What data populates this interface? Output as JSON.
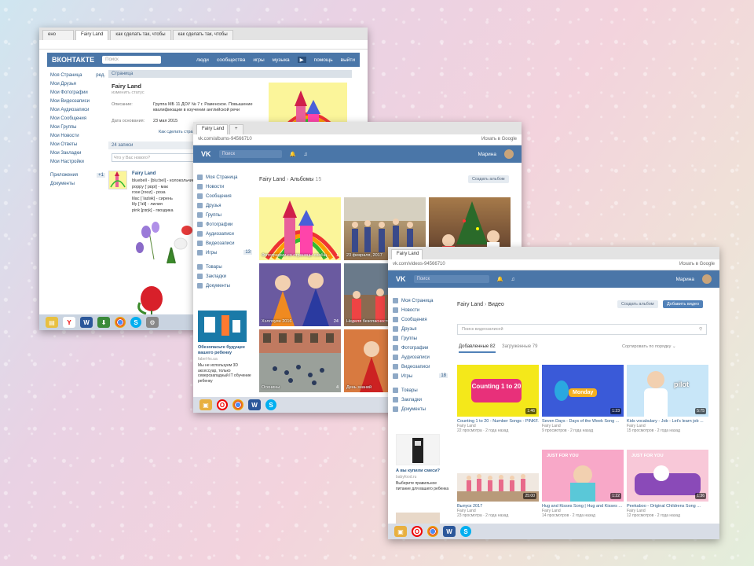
{
  "win1": {
    "tabs": [
      "Fairy Land",
      "как сделать так, чтобы",
      "как сделать так, чтобы"
    ],
    "logo": "ВКОНТАКТЕ",
    "search_placeholder": "Поиск",
    "top_links": [
      "люди",
      "сообщества",
      "игры",
      "музыка",
      "помощь",
      "выйти"
    ],
    "back": "ред.",
    "nav": [
      "Моя Страница",
      "Мои Друзья",
      "Мои Фотографии",
      "Мои Видеозаписи",
      "Мои Аудиозаписи",
      "Мои Сообщения",
      "Мои Группы",
      "Мои Новости",
      "Мои Ответы",
      "Мои Закладки",
      "Мои Настройки",
      "Приложения",
      "Документы"
    ],
    "apps_count": "+1",
    "header": "Страница",
    "group_name": "Fairy Land",
    "group_status": "изменить статус",
    "desc_label": "Описание:",
    "desc_text": "Группа МБ 11 ДОУ № 7 г. Раменское. Повышение квалификации в изучении английской речи",
    "date_label": "Дата основания:",
    "date_value": "23 мая 2015",
    "hint": "Как сделать стра",
    "posts_header": "24 записи",
    "post_placeholder": "Что у Вас нового?",
    "post_author": "Fairy Land",
    "post_lines": [
      "bluebell - [blu:bel] - колокольчик",
      "poppy [ˈpɒpi] - мак",
      "rose [rəʊz] - роза",
      "lilac [ˈlaɪlək] - сирень",
      "lily [ˈlɪli] - лилия",
      "pink [pɪŋk] - гвоздика"
    ]
  },
  "win2": {
    "tabs": [
      "Fairy Land",
      "+"
    ],
    "url": "vk.com/albums-94566710",
    "google": "Искать в Google",
    "search_placeholder": "Поиск",
    "user": "Марина",
    "nav": [
      "Моя Страница",
      "Новости",
      "Сообщения",
      "Друзья",
      "Группы",
      "Фотографии",
      "Аудиозаписи",
      "Видеозаписи",
      "Игры",
      "Товары",
      "Закладки",
      "Документы"
    ],
    "games_count": "13",
    "breadcrumb_group": "Fairy Land",
    "breadcrumb_page": "Альбомы",
    "breadcrumb_count": "15",
    "create_album": "Создать альбом",
    "albums": [
      {
        "caption": "Фотографии со страницы сообщ...",
        "count": "1"
      },
      {
        "caption": "23 февраля, 2017",
        "count": ""
      },
      {
        "caption": "",
        "count": ""
      },
      {
        "caption": "Хэллоуин 2016",
        "count": "24"
      },
      {
        "caption": "Неделя безопасности",
        "count": ""
      },
      {
        "caption": "Осенины",
        "count": "4"
      },
      {
        "caption": "День знаний",
        "count": ""
      }
    ],
    "ad_title": "Обезопасьте будущее вашего ребенку",
    "ad_site": "fabel-hs.ua",
    "ad_text": "Мы не используем 3D аксессуар, только северозападный IT обучение ребенку"
  },
  "win3": {
    "tab": "Fairy Land",
    "url": "vk.com/videos-94566710",
    "google": "Искать в Google",
    "search_placeholder": "Поиск",
    "user": "Марина",
    "nav": [
      "Моя Страница",
      "Новости",
      "Сообщения",
      "Друзья",
      "Группы",
      "Фотографии",
      "Аудиозаписи",
      "Видеозаписи",
      "Игры",
      "Товары",
      "Закладки",
      "Документы"
    ],
    "games_count": "18",
    "breadcrumb_group": "Fairy Land",
    "breadcrumb_page": "Видео",
    "btn_create_album": "Создать альбом",
    "btn_add_video": "Добавить видео",
    "video_search_placeholder": "Поиск видеозаписей",
    "tab_added": "Добавленные 82",
    "tab_uploaded": "Загруженные 79",
    "sort": "Сортировать по порядку",
    "videos": [
      {
        "title": "Counting 1 to 20 - Number Songs - PINKF...",
        "author": "Fairy Land",
        "views": "22 просмотра · 2 года назад",
        "dur": "1:46",
        "thumb_text": "Counting 1 to 20"
      },
      {
        "title": "Seven Days - Days of the Week Song ...",
        "author": "Fairy Land",
        "views": "9 просмотров · 2 года назад",
        "dur": "1:23",
        "thumb_text": "Monday"
      },
      {
        "title": "Kids vocabulary - Job - Let's learn job ...",
        "author": "Fairy Land",
        "views": "15 просмотров · 2 года назад",
        "dur": "5:75",
        "thumb_text": "pilot"
      },
      {
        "title": "Выпуск 2017",
        "author": "Fairy Land",
        "views": "23 просмотра · 2 года назад",
        "dur": "25:00",
        "thumb_text": ""
      },
      {
        "title": "Hug and Kisses Song | Hug and Kisses ...",
        "author": "Fairy Land",
        "views": "14 просмотров · 2 года назад",
        "dur": "1:22",
        "thumb_text": "JUST FOR YOU"
      },
      {
        "title": "Peekaboo - Original Childrens Song ...",
        "author": "Fairy Land",
        "views": "12 просмотров · 2 года назад",
        "dur": "1:36",
        "thumb_text": "JUST FOR YOU"
      }
    ],
    "ad_title": "А вы купили смеси?",
    "ad_site": "babyfood.ru",
    "ad_text": "Выберите правильное питание для вашего ребенка"
  },
  "taskbar_icons": [
    "start",
    "opera",
    "chrome",
    "word",
    "skype"
  ]
}
